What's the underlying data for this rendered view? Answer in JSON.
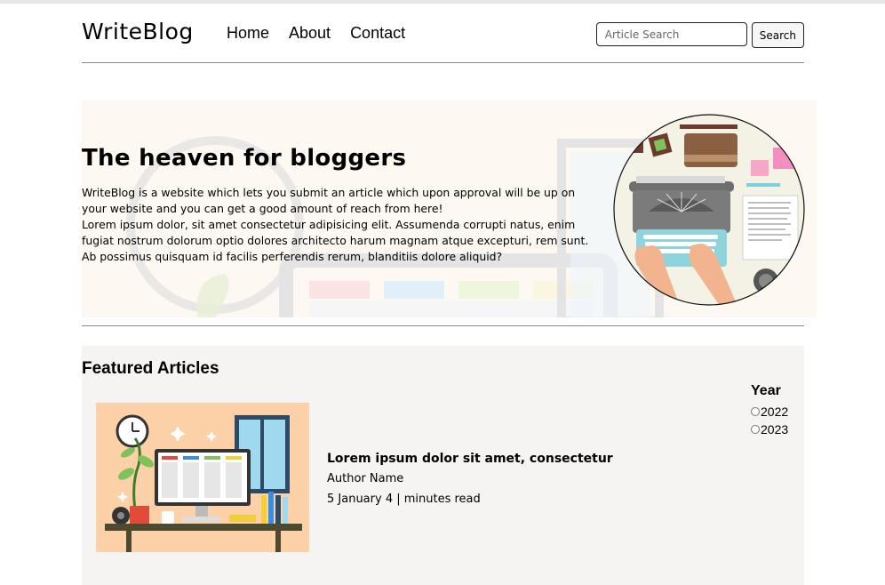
{
  "header": {
    "brand": "WriteBlog",
    "nav": [
      "Home",
      "About",
      "Contact"
    ],
    "search_placeholder": "Article Search",
    "search_button": "Search"
  },
  "hero": {
    "title": "The heaven for bloggers",
    "paragraph1": "WriteBlog is a website which lets you submit an article which upon approval will be up on your website and you can get a good amount of reach from here!",
    "paragraph2": "Lorem ipsum dolor, sit amet consectetur adipisicing elit. Assumenda corrupti natus, enim fugiat nostrum dolorum optio dolores architecto harum magnam atque excepturi, rem sunt. Ab possimus quisquam id facilis perferendis rerum, blanditiis dolore aliquid?"
  },
  "featured": {
    "title": "Featured Articles",
    "article": {
      "title": "Lorem ipsum dolor sit amet, consectetur",
      "author": "Author Name",
      "meta": "5 January 4 | minutes read"
    },
    "filter": {
      "title": "Year",
      "options": [
        "2022",
        "2023"
      ]
    }
  },
  "colors": {
    "hero_bg": "#fdf9f2",
    "featured_bg": "#f5f4f3",
    "article_img_bg": "#fdd1a8"
  },
  "icons": [
    "typewriter-illustration",
    "desk-illustration",
    "radio-button"
  ]
}
